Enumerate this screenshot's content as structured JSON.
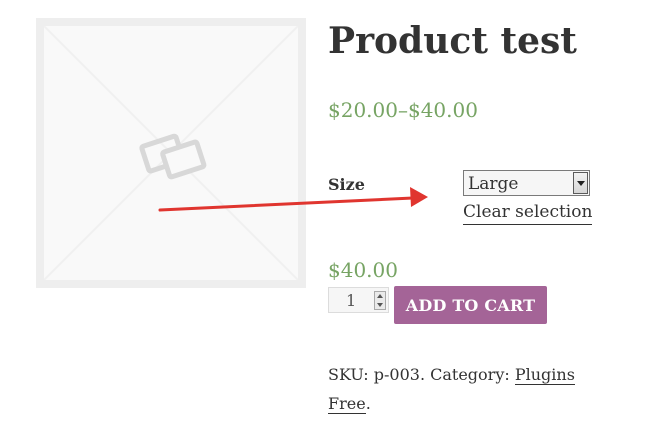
{
  "product": {
    "title": "Product test",
    "price_range": "$20.00–$40.00",
    "image_icon": "photo-placeholder-icon"
  },
  "variations": {
    "size_label": "Size",
    "size_selected": "Large",
    "clear_label": "Clear selection"
  },
  "annotation": {
    "icon": "red-arrow-icon",
    "color": "#e0352f"
  },
  "variation_price": "$40.00",
  "quantity": "1",
  "add_to_cart_label": "ADD TO CART",
  "meta": {
    "sku_prefix": "SKU:",
    "sku": "p-003",
    "category_prefix": ". Category:",
    "category": "Plugins Free",
    "suffix": "."
  },
  "colors": {
    "price": "#77a464",
    "button": "#a46497",
    "text": "#333333"
  }
}
